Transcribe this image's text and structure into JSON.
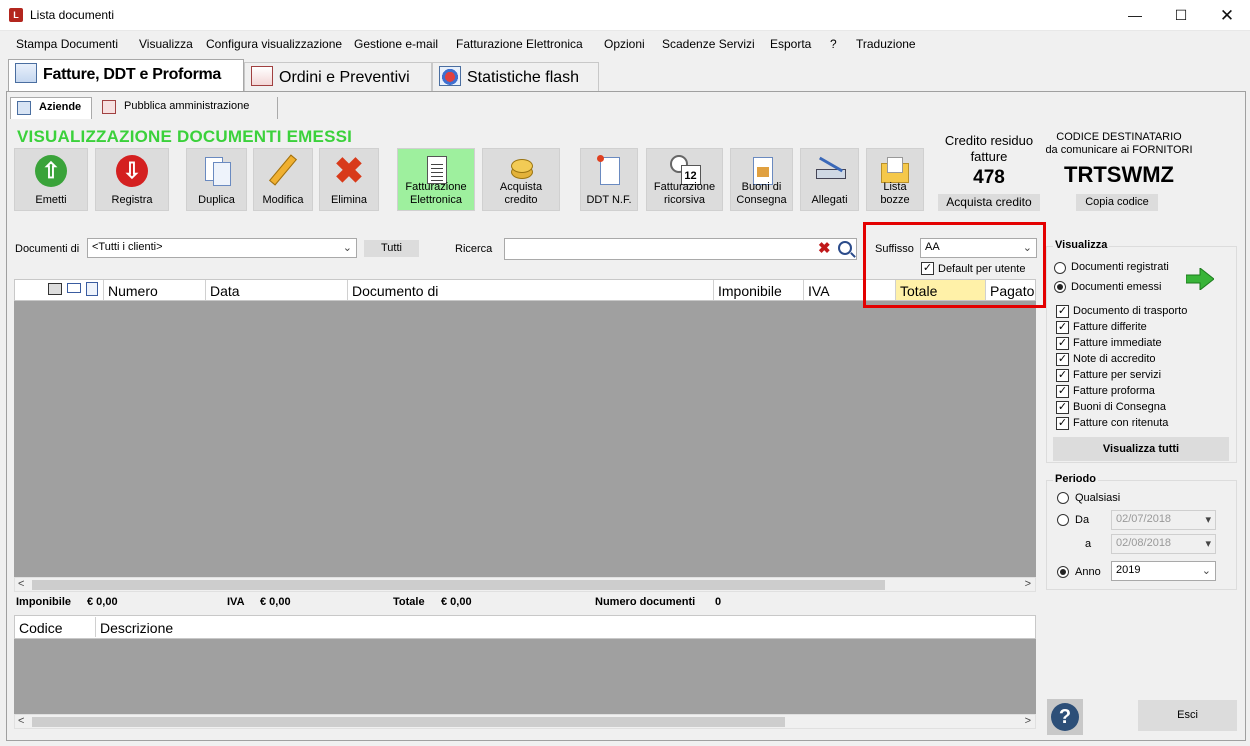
{
  "window": {
    "title": "Lista documenti",
    "app_icon_text": "L"
  },
  "menu": [
    "Stampa Documenti",
    "Visualizza",
    "Configura visualizzazione",
    "Gestione e-mail",
    "Fatturazione Elettronica",
    "Opzioni",
    "Scadenze Servizi",
    "Esporta",
    "?",
    "Traduzione"
  ],
  "tabs": [
    "Fatture, DDT e Proforma",
    "Ordini e Preventivi",
    "Statistiche flash"
  ],
  "subtabs": [
    "Aziende",
    "Pubblica amministrazione"
  ],
  "section_title": "VISUALIZZAZIONE DOCUMENTI EMESSI",
  "toolbar": {
    "emetti": "Emetti",
    "registra": "Registra",
    "duplica": "Duplica",
    "modifica": "Modifica",
    "elimina": "Elimina",
    "fatturazione_elettronica": [
      "Fatturazione",
      "Elettronica"
    ],
    "acquista_credito": [
      "Acquista",
      "credito"
    ],
    "ddt_nf": "DDT N.F.",
    "fatturazione_ricorsiva": [
      "Fatturazione",
      "ricorsiva"
    ],
    "calendar_day": "12",
    "buoni_consegna": [
      "Buoni di",
      "Consegna"
    ],
    "allegati": "Allegati",
    "lista_bozze": [
      "Lista",
      "bozze"
    ]
  },
  "credito": {
    "title": [
      "Credito residuo",
      "fatture"
    ],
    "value": "478",
    "button": "Acquista credito"
  },
  "codice": {
    "label": [
      "CODICE DESTINATARIO",
      "da comunicare ai FORNITORI"
    ],
    "value": "TRTSWMZ",
    "button": "Copia codice"
  },
  "filters": {
    "documenti_di_label": "Documenti di",
    "documenti_di_value": "<Tutti i clienti>",
    "tutti_button": "Tutti",
    "ricerca_label": "Ricerca",
    "ricerca_value": "",
    "suffisso_label": "Suffisso",
    "suffisso_value": "AA",
    "default_label": "Default per utente"
  },
  "grid": {
    "columns": [
      "Numero",
      "Data",
      "Documento di",
      "Imponibile",
      "IVA",
      "Totale",
      "Pagato"
    ]
  },
  "totals": {
    "imponibile_label": "Imponibile",
    "imponibile_value": "€ 0,00",
    "iva_label": "IVA",
    "iva_value": "€ 0,00",
    "totale_label": "Totale",
    "totale_value": "€ 0,00",
    "numero_label": "Numero documenti",
    "numero_value": "0"
  },
  "grid2": {
    "columns": [
      "Codice",
      "Descrizione"
    ]
  },
  "visualizza": {
    "title": "Visualizza",
    "radio": [
      "Documenti registrati",
      "Documenti emessi"
    ],
    "checkboxes": [
      "Documento di trasporto",
      "Fatture differite",
      "Fatture immediate",
      "Note di accredito",
      "Fatture per servizi",
      "Fatture proforma",
      "Buoni di Consegna",
      "Fatture con ritenuta"
    ],
    "button": "Visualizza tutti"
  },
  "periodo": {
    "title": "Periodo",
    "qualsiasi": "Qualsiasi",
    "da": "Da",
    "da_value": "02/07/2018",
    "a": "a",
    "a_value": "02/08/2018",
    "anno": "Anno",
    "anno_value": "2019"
  },
  "help": "?",
  "esci": "Esci",
  "colors": {
    "section_title": "#3bd13b",
    "highlight": "#e30000",
    "grid_bg": "#a0a0a0",
    "totale_col": "#fff1a8"
  }
}
